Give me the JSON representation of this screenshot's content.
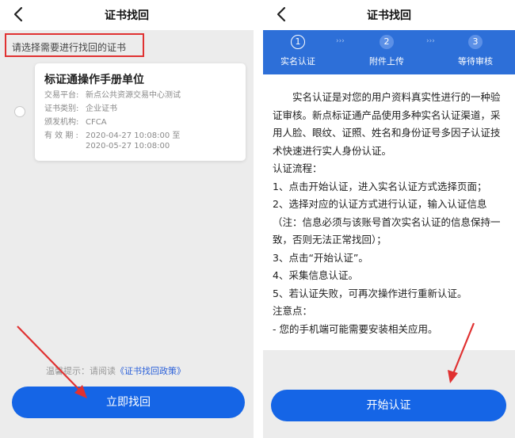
{
  "left_screen": {
    "nav_title": "证书找回",
    "select_hint": "请选择需要进行找回的证书",
    "certificate": {
      "name": "标证通操作手册单位",
      "rows": [
        {
          "label": "交易平台:",
          "value": "新点公共资源交易中心测试"
        },
        {
          "label": "证书类别:",
          "value": "企业证书"
        },
        {
          "label": "颁发机构:",
          "value": "CFCA"
        },
        {
          "label": "有 效 期 :",
          "value": "2020-04-27 10:08:00 至"
        },
        {
          "label": "",
          "value": "2020-05-27 10:08:00"
        }
      ]
    },
    "tip_label": "温馨提示：请阅读",
    "tip_link": "《证书找回政策》",
    "button_label": "立即找回"
  },
  "right_screen": {
    "nav_title": "证书找回",
    "steps": [
      {
        "number": "1",
        "label": "实名认证",
        "active": true
      },
      {
        "number": "2",
        "label": "附件上传",
        "active": false
      },
      {
        "number": "3",
        "label": "等待审核",
        "active": false
      }
    ],
    "step_separator": "›››",
    "paragraphs": [
      "实名认证是对您的用户资料真实性进行的一种验证审核。新点标证通产品使用多种实名认证渠道，采用人脸、眼纹、证照、姓名和身份证号多因子认证技术快速进行实人身份认证。",
      "认证流程：",
      "1、点击开始认证，进入实名认证方式选择页面；",
      "2、选择对应的认证方式进行认证，输入认证信息（注：信息必须与该账号首次实名认证的信息保持一致，否则无法正常找回）；",
      "3、点击“开始认证”。",
      "4、采集信息认证。",
      "5、若认证失败，可再次操作进行重新认证。",
      "注意点：",
      "- 您的手机端可能需要安装相关应用。"
    ],
    "button_label": "开始认证"
  },
  "colors": {
    "primary_blue": "#1565e6",
    "steps_bar_blue": "#2d6fd8",
    "annotation_red": "#e03131",
    "link_blue": "#2c61d9"
  },
  "icons": [
    "back-icon",
    "radio-icon",
    "annotation-arrow"
  ]
}
